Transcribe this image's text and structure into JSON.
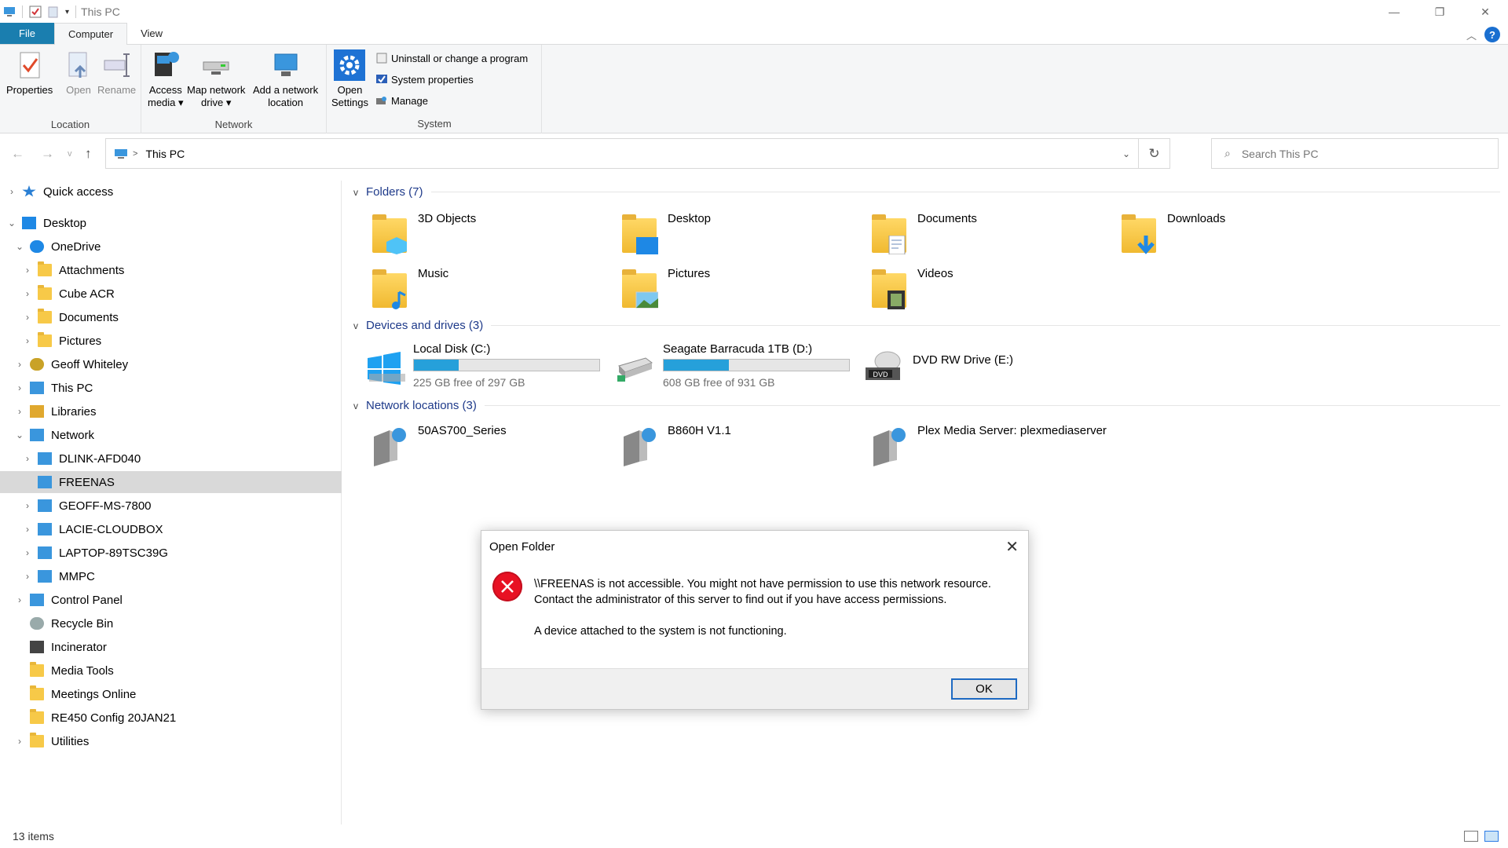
{
  "window": {
    "title": "This PC"
  },
  "ribbon": {
    "tabs": [
      "File",
      "Computer",
      "View"
    ],
    "location": {
      "label": "Location",
      "properties": "Properties",
      "open": "Open",
      "rename": "Rename"
    },
    "network": {
      "label": "Network",
      "access_media": [
        "Access",
        "media ▾"
      ],
      "map_drive": [
        "Map network",
        "drive ▾"
      ],
      "add_location": [
        "Add a network",
        "location"
      ]
    },
    "system": {
      "label": "System",
      "open_settings": [
        "Open",
        "Settings"
      ],
      "uninstall": "Uninstall or change a program",
      "system_properties": "System properties",
      "manage": "Manage"
    }
  },
  "address": {
    "crumb": "This PC",
    "search_placeholder": "Search This PC"
  },
  "nav": {
    "items": [
      {
        "label": "Quick access",
        "indent": 0,
        "chev": ">"
      },
      {
        "label": "Desktop",
        "indent": 0,
        "chev": "v"
      },
      {
        "label": "OneDrive",
        "indent": 1,
        "chev": "v"
      },
      {
        "label": "Attachments",
        "indent": 2,
        "chev": ">"
      },
      {
        "label": "Cube ACR",
        "indent": 2,
        "chev": ">"
      },
      {
        "label": "Documents",
        "indent": 2,
        "chev": ">"
      },
      {
        "label": "Pictures",
        "indent": 2,
        "chev": ">"
      },
      {
        "label": "Geoff Whiteley",
        "indent": 1,
        "chev": ">"
      },
      {
        "label": "This PC",
        "indent": 1,
        "chev": ">"
      },
      {
        "label": "Libraries",
        "indent": 1,
        "chev": ">"
      },
      {
        "label": "Network",
        "indent": 1,
        "chev": "v"
      },
      {
        "label": "DLINK-AFD040",
        "indent": 2,
        "chev": ">"
      },
      {
        "label": "FREENAS",
        "indent": 2,
        "chev": ""
      },
      {
        "label": "GEOFF-MS-7800",
        "indent": 2,
        "chev": ">"
      },
      {
        "label": "LACIE-CLOUDBOX",
        "indent": 2,
        "chev": ">"
      },
      {
        "label": "LAPTOP-89TSC39G",
        "indent": 2,
        "chev": ">"
      },
      {
        "label": "MMPC",
        "indent": 2,
        "chev": ">"
      },
      {
        "label": "Control Panel",
        "indent": 1,
        "chev": ">"
      },
      {
        "label": "Recycle Bin",
        "indent": 1,
        "chev": ""
      },
      {
        "label": "Incinerator",
        "indent": 1,
        "chev": ""
      },
      {
        "label": "Media Tools",
        "indent": 1,
        "chev": ""
      },
      {
        "label": "Meetings Online",
        "indent": 1,
        "chev": ""
      },
      {
        "label": "RE450 Config 20JAN21",
        "indent": 1,
        "chev": ""
      },
      {
        "label": "Utilities",
        "indent": 1,
        "chev": ">"
      }
    ]
  },
  "content": {
    "folders_header": "Folders (7)",
    "folders": [
      "3D Objects",
      "Desktop",
      "Documents",
      "Downloads",
      "Music",
      "Pictures",
      "Videos"
    ],
    "drives_header": "Devices and drives (3)",
    "drives": [
      {
        "name": "Local Disk (C:)",
        "free": "225 GB free of 297 GB",
        "used_fraction": 0.24
      },
      {
        "name": "Seagate Barracuda 1TB (D:)",
        "free": "608 GB free of 931 GB",
        "used_fraction": 0.35
      },
      {
        "name": "DVD RW Drive (E:)"
      }
    ],
    "network_header": "Network locations (3)",
    "network": [
      "50AS700_Series",
      "B860H V1.1",
      "Plex Media Server: plexmediaserver"
    ]
  },
  "status": {
    "items": "13 items"
  },
  "dialog": {
    "title": "Open Folder",
    "line1": "\\\\FREENAS is not accessible. You might not have permission to use this network resource.",
    "line2": "Contact the administrator of this server to find out if you have access permissions.",
    "line3": "A device attached to the system is not functioning.",
    "ok": "OK"
  }
}
